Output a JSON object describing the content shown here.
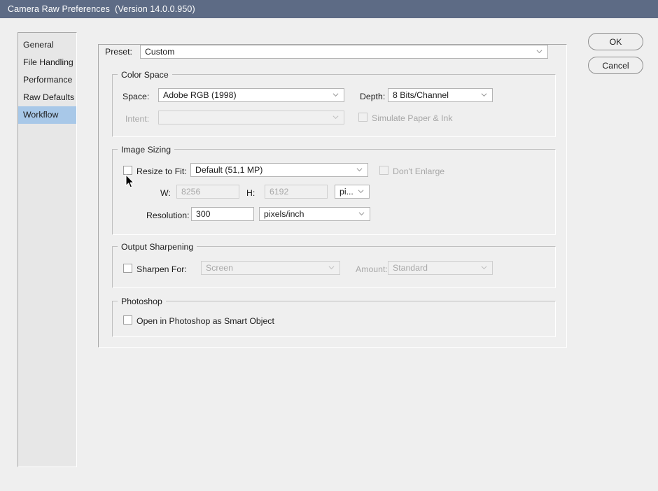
{
  "window": {
    "title": "Camera Raw Preferences  (Version 14.0.0.950)"
  },
  "sidebar": {
    "items": [
      {
        "label": "General",
        "selected": false
      },
      {
        "label": "File Handling",
        "selected": false
      },
      {
        "label": "Performance",
        "selected": false
      },
      {
        "label": "Raw Defaults",
        "selected": false
      },
      {
        "label": "Workflow",
        "selected": true
      }
    ]
  },
  "buttons": {
    "ok": "OK",
    "cancel": "Cancel"
  },
  "preset": {
    "label": "Preset:",
    "value": "Custom"
  },
  "color_space": {
    "title": "Color Space",
    "space_label": "Space:",
    "space_value": "Adobe RGB (1998)",
    "depth_label": "Depth:",
    "depth_value": "8 Bits/Channel",
    "intent_label": "Intent:",
    "intent_value": "",
    "simulate_label": "Simulate Paper & Ink"
  },
  "image_sizing": {
    "title": "Image Sizing",
    "resize_label": "Resize to Fit:",
    "resize_value": "Default  (51,1 MP)",
    "dont_enlarge_label": "Don't Enlarge",
    "w_label": "W:",
    "w_value": "8256",
    "h_label": "H:",
    "h_value": "6192",
    "units_value": "pi...",
    "resolution_label": "Resolution:",
    "resolution_value": "300",
    "resolution_units": "pixels/inch"
  },
  "output_sharpening": {
    "title": "Output Sharpening",
    "sharpen_label": "Sharpen For:",
    "sharpen_value": "Screen",
    "amount_label": "Amount:",
    "amount_value": "Standard"
  },
  "photoshop": {
    "title": "Photoshop",
    "smart_object_label": "Open in Photoshop as Smart Object"
  },
  "colors": {
    "titlebar": "#5d6b85",
    "background": "#efefef",
    "selection": "#a8c8e8"
  }
}
